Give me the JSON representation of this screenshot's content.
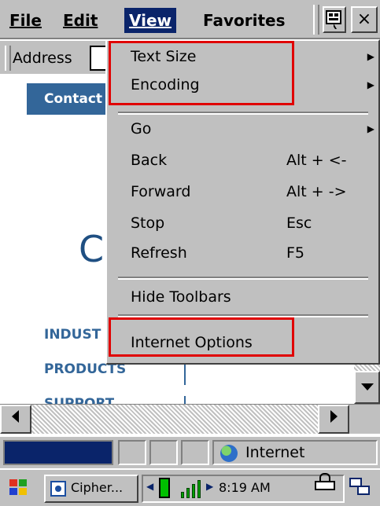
{
  "menubar": {
    "file": "File",
    "edit": "Edit",
    "view": "View",
    "favorites": "Favorites",
    "close": "×"
  },
  "addressbar": {
    "label": "Address"
  },
  "page": {
    "contact_tab": "Contact",
    "big_letter": "C",
    "nav": [
      "INDUST",
      "PRODUCTS",
      "SUPPORT"
    ]
  },
  "view_menu": {
    "items": [
      {
        "label": "Text Size",
        "shortcut": "",
        "submenu": true
      },
      {
        "label": "Encoding",
        "shortcut": "",
        "submenu": true
      },
      {
        "label": "Go",
        "shortcut": "",
        "submenu": true
      },
      {
        "label": "Back",
        "shortcut": "Alt + <-",
        "submenu": false
      },
      {
        "label": "Forward",
        "shortcut": "Alt + ->",
        "submenu": false
      },
      {
        "label": "Stop",
        "shortcut": "Esc",
        "submenu": false
      },
      {
        "label": "Refresh",
        "shortcut": "F5",
        "submenu": false
      },
      {
        "label": "Hide Toolbars",
        "shortcut": "",
        "submenu": false
      },
      {
        "label": "Internet Options",
        "shortcut": "",
        "submenu": false
      }
    ]
  },
  "statusbar": {
    "zone": "Internet"
  },
  "taskbar": {
    "task_label": "Cipher...",
    "clock": "8:19 AM"
  },
  "colors": {
    "highlight": "#0a246a",
    "annotation": "#e00000",
    "site_blue": "#336699"
  }
}
